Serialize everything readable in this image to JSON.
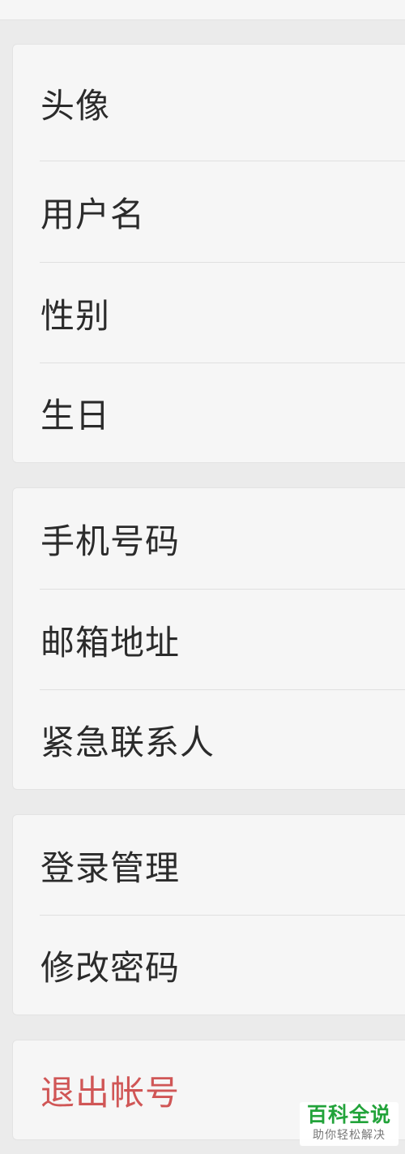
{
  "sections": [
    {
      "items": [
        {
          "label": "头像"
        },
        {
          "label": "用户名"
        },
        {
          "label": "性别"
        },
        {
          "label": "生日"
        }
      ]
    },
    {
      "items": [
        {
          "label": "手机号码"
        },
        {
          "label": "邮箱地址"
        },
        {
          "label": "紧急联系人"
        }
      ]
    },
    {
      "items": [
        {
          "label": "登录管理"
        },
        {
          "label": "修改密码"
        }
      ]
    },
    {
      "items": [
        {
          "label": "退出帐号",
          "color": "#d05656"
        }
      ]
    }
  ],
  "watermark": {
    "title": "百科全说",
    "subtitle": "助你轻松解决"
  }
}
